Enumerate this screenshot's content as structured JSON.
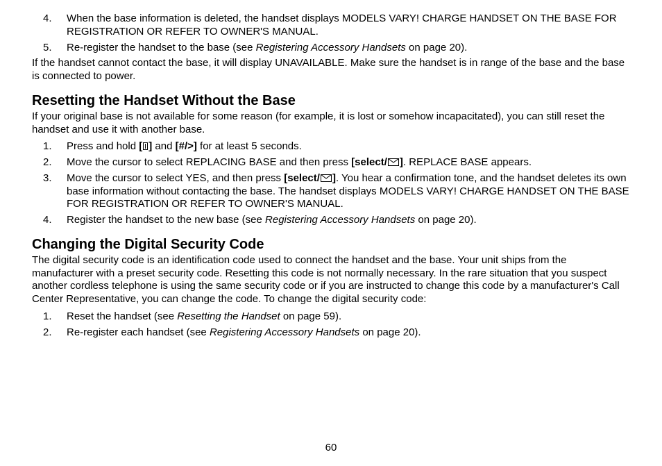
{
  "topList": [
    {
      "num": "4.",
      "text": "When the base information is deleted, the handset displays MODELS VARY! CHARGE HANDSET ON THE BASE FOR REGISTRATION OR REFER TO OWNER'S MANUAL."
    },
    {
      "num": "5.",
      "pre": "Re-register the handset to the base (see ",
      "em": "Registering Accessory Handsets",
      "post": " on page 20)."
    }
  ],
  "topPara": "If the handset cannot contact the base, it will display UNAVAILABLE. Make sure the handset is in range of the base and the base is connected to power.",
  "section1": {
    "heading": "Resetting the Handset Without the Base",
    "intro": "If your original base is not available for some reason (for example, it is lost or somehow incapacitated), you can still reset the handset and use it with another base.",
    "items": {
      "i1": {
        "num": "1.",
        "a": "Press and hold ",
        "b1": "[",
        "b2": "]",
        "c": " and ",
        "d": "[#/>]",
        "e": " for at least 5 seconds."
      },
      "i2": {
        "num": "2.",
        "a": "Move the cursor to select REPLACING BASE and then press ",
        "b1": "[select/",
        "b2": "]",
        "c": ". REPLACE BASE appears."
      },
      "i3": {
        "num": "3.",
        "a": "Move the cursor to select YES, and then press ",
        "b1": "[select/",
        "b2": "]",
        "c": ". You hear a confirmation tone, and the handset deletes its own base information without contacting the base. The handset displays MODELS VARY! CHARGE HANDSET ON THE BASE FOR REGISTRATION OR REFER TO OWNER'S MANUAL."
      },
      "i4": {
        "num": "4.",
        "a": "Register the handset to the new base (see ",
        "em": "Registering Accessory Handsets",
        "b": " on page 20)."
      }
    }
  },
  "section2": {
    "heading": "Changing the Digital Security Code",
    "intro": "The digital security code is an identification code used to connect the handset and the base. Your unit ships from the manufacturer with a preset security code. Resetting this code is not normally necessary. In the rare situation that you suspect another cordless telephone is using the same security code or if you are instructed to change this code by a manufacturer's Call Center Representative, you can change the code. To change the digital security code:",
    "items": {
      "i1": {
        "num": "1.",
        "a": "Reset the handset (see ",
        "em": "Resetting the Handset",
        "b": " on page 59)."
      },
      "i2": {
        "num": "2.",
        "a": "Re-register each handset (see ",
        "em": "Registering Accessory Handsets",
        "b": " on page 20)."
      }
    }
  },
  "pageNumber": "60"
}
